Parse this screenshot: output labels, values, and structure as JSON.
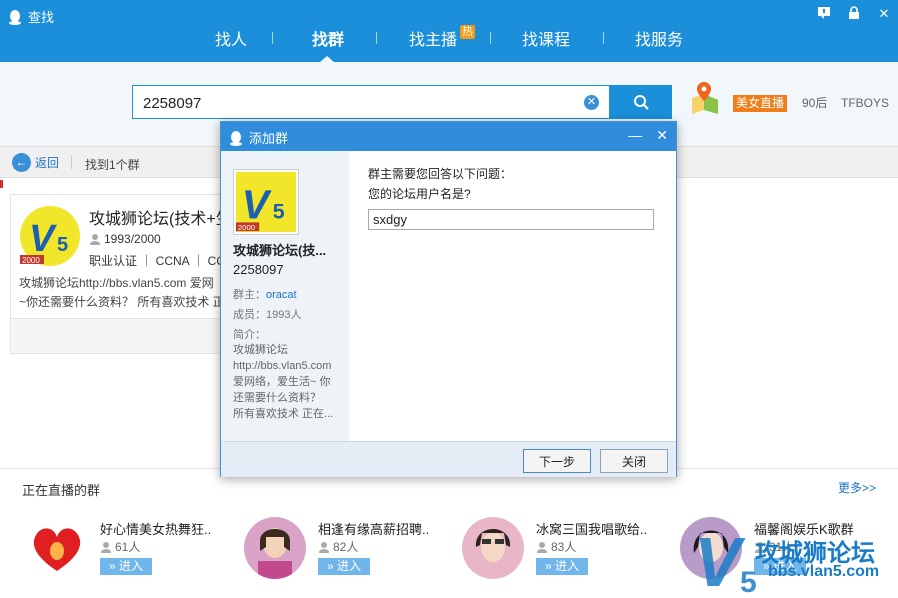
{
  "window": {
    "title": "查找"
  },
  "nav": {
    "items": [
      "找人",
      "找群",
      "找主播",
      "找课程",
      "找服务"
    ],
    "active": "找群",
    "hot_badge": "热"
  },
  "search": {
    "value": "2258097"
  },
  "hot_tags": {
    "live_badge": "美女直播",
    "tag1": "90后",
    "tag2": "TFBOYS"
  },
  "result_bar": {
    "back_label": "返回",
    "count_text": "找到1个群"
  },
  "group_card": {
    "name": "攻城狮论坛(技术+生",
    "members": "1993/2000",
    "cert": "职业认证 ｜ CCNA ｜ CCNP",
    "desc": "攻城狮论坛http://bbs.vlan5.com 爱网\n~你还需要什么资料？ 所有喜欢技术 正"
  },
  "dialog": {
    "title": "添加群",
    "group_name": "攻城狮论坛(技...",
    "group_id": "2258097",
    "owner_label": "群主：",
    "owner": "oracat",
    "members": "成员：1993人",
    "intro_label": "简介：",
    "intro": "攻城狮论坛\nhttp://bbs.vlan5.com\n爱网络，爱生活~ 你\n还需要什么资料？\n所有喜欢技术 正在...",
    "question_intro": "群主需要您回答以下问题：",
    "question": "您的论坛用户名是?",
    "answer": "sxdgy",
    "next_label": "下一步",
    "close_label": "关闭"
  },
  "live": {
    "title": "正在直播的群",
    "more": "更多>>",
    "enter_label": "» 进入",
    "items": [
      {
        "name": "好心情美女热舞狂..",
        "count": "61人"
      },
      {
        "name": "相逢有缘高薪招聘..",
        "count": "82人"
      },
      {
        "name": "冰窝三国我唱歌给..",
        "count": "83人"
      },
      {
        "name": "福馨阁娱乐K歌群",
        "count": "31人"
      }
    ]
  },
  "watermark": {
    "text": "攻城狮论坛",
    "url": "bbs.vlan5.com"
  },
  "colors": {
    "primary": "#1b8fd9",
    "dialog_title": "#2f8ddb",
    "badge_orange": "#f07d18"
  }
}
